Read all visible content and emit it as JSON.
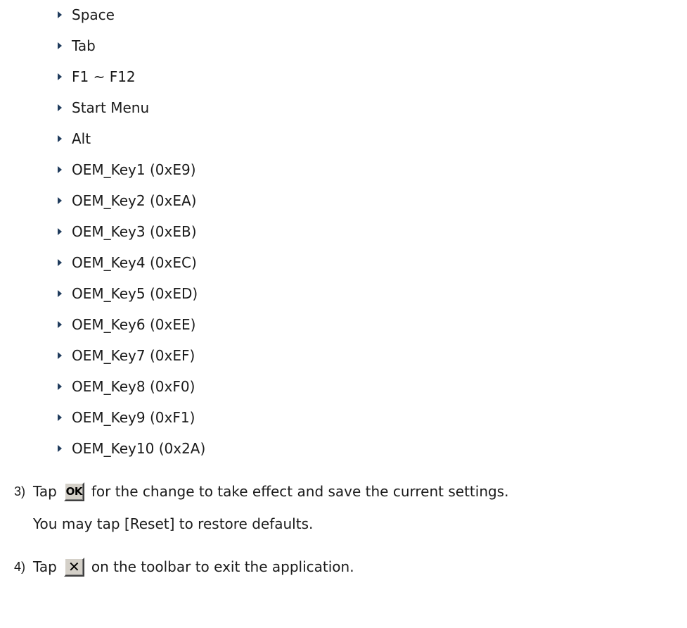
{
  "bullets": [
    "Space",
    "Tab",
    "F1 ~ F12",
    "Start Menu",
    "Alt",
    "OEM_Key1 (0xE9)",
    "OEM_Key2 (0xEA)",
    "OEM_Key3 (0xEB)",
    "OEM_Key4 (0xEC)",
    "OEM_Key5 (0xED)",
    "OEM_Key6 (0xEE)",
    "OEM_Key7 (0xEF)",
    "OEM_Key8 (0xF0)",
    "OEM_Key9 (0xF1)",
    "OEM_Key10 (0x2A)"
  ],
  "step3": {
    "number": "3)",
    "before": "Tap",
    "icon_label": "OK",
    "icon": "ok-button-icon",
    "after": "for the change to take effect and save the current settings.",
    "note": "You may tap [Reset] to restore defaults."
  },
  "step4": {
    "number": "4)",
    "before": "Tap",
    "icon_label": "✕",
    "icon": "close-button-icon",
    "after": "on the toolbar to exit the application."
  }
}
